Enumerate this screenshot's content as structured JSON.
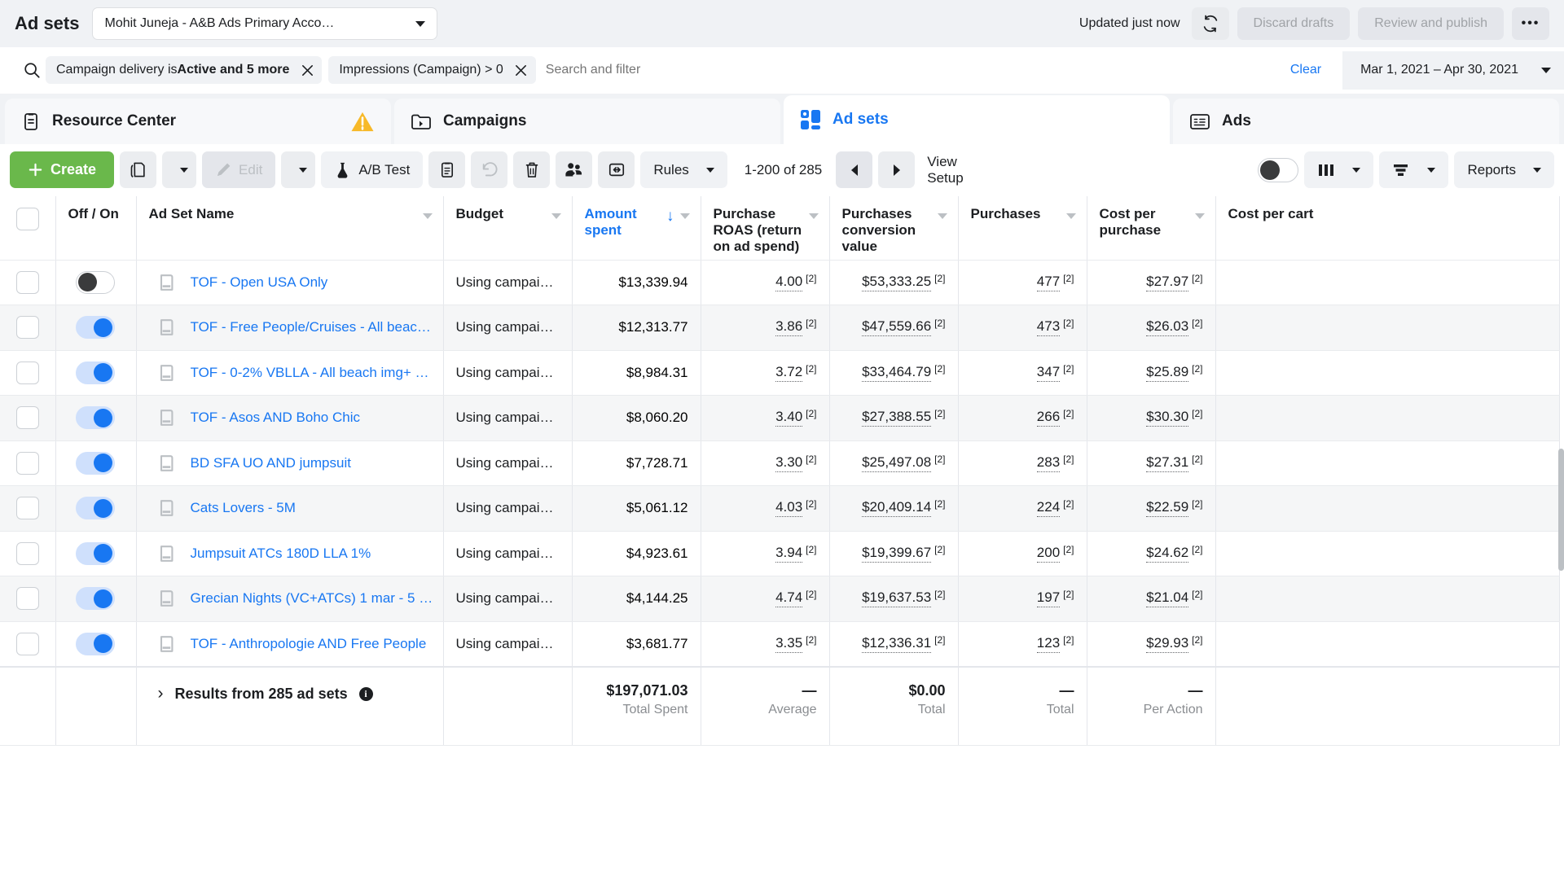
{
  "header": {
    "page_title": "Ad sets",
    "account_name": "Mohit Juneja - A&B Ads Primary Acco…",
    "updated_text": "Updated just now",
    "refresh_icon": "refresh-icon",
    "discard_drafts_label": "Discard drafts",
    "review_publish_label": "Review and publish",
    "more_label": "•••"
  },
  "filterbar": {
    "search_icon": "search-icon",
    "pills": [
      {
        "prefix": "Campaign delivery is ",
        "bold": "Active and 5 more",
        "close_icon": "close-icon"
      },
      {
        "prefix": "Impressions (Campaign) > 0",
        "bold": "",
        "close_icon": "close-icon"
      }
    ],
    "placeholder": "Search and filter",
    "clear_label": "Clear",
    "date_range": "Mar 1, 2021 – Apr 30, 2021"
  },
  "tabs": [
    {
      "label": "Resource Center",
      "icon": "clipboard-icon",
      "active": false,
      "warning_icon": "warning-triangle-icon"
    },
    {
      "label": "Campaigns",
      "icon": "campaign-folder-icon",
      "active": false,
      "warning_icon": ""
    },
    {
      "label": "Ad sets",
      "icon": "adsets-grid-icon",
      "active": true,
      "warning_icon": ""
    },
    {
      "label": "Ads",
      "icon": "ads-card-icon",
      "active": false,
      "warning_icon": ""
    }
  ],
  "toolbar": {
    "create_label": "Create",
    "duplicate_icon": "duplicate-icon",
    "duplicate_caret_icon": "chevron-down-icon",
    "edit_label": "Edit",
    "edit_icon": "pencil-icon",
    "edit_caret_icon": "chevron-down-icon",
    "ab_test_label": "A/B Test",
    "ab_test_icon": "flask-icon",
    "clipboard_icon": "clipboard-copy-icon",
    "undo_icon": "undo-icon",
    "delete_icon": "trash-icon",
    "audience_icon": "audience-export-icon",
    "share_icon": "share-arrow-icon",
    "rules_label": "Rules",
    "rules_caret_icon": "chevron-down-icon",
    "pagination_count": "1-200 of 285",
    "prev_icon": "triangle-left-icon",
    "next_icon": "triangle-right-icon",
    "view_setup_line1": "View",
    "view_setup_line2": "Setup",
    "view_toggle_icon": "toggle-switch-off",
    "columns_icon": "columns-icon",
    "columns_caret_icon": "chevron-down-icon",
    "breakdown_icon": "breakdown-icon",
    "breakdown_caret_icon": "chevron-down-icon",
    "reports_label": "Reports",
    "reports_caret_icon": "chevron-down-icon"
  },
  "table": {
    "columns": [
      {
        "key": "checkbox",
        "label": "",
        "align": "center",
        "menu": false
      },
      {
        "key": "offon",
        "label": "Off / On",
        "align": "left",
        "menu": false
      },
      {
        "key": "name",
        "label": "Ad Set Name",
        "align": "left",
        "menu": true
      },
      {
        "key": "budget",
        "label": "Budget",
        "align": "left",
        "menu": true
      },
      {
        "key": "spent",
        "label": "Amount spent",
        "align": "right",
        "menu": true,
        "sorted": true,
        "sort_dir": "↓"
      },
      {
        "key": "roas",
        "label": "Purchase ROAS (return on ad spend)",
        "align": "right",
        "menu": true
      },
      {
        "key": "convvalue",
        "label": "Purchases conversion value",
        "align": "right",
        "menu": true
      },
      {
        "key": "purchases",
        "label": "Purchases",
        "align": "right",
        "menu": true
      },
      {
        "key": "cpp",
        "label": "Cost per purchase",
        "align": "right",
        "menu": true
      },
      {
        "key": "cpc",
        "label": "Cost per cart",
        "align": "right",
        "menu": false
      }
    ],
    "rows": [
      {
        "on": false,
        "name": "TOF - Open USA Only",
        "icon": "mobile-placement-icon",
        "budget": "Using campaig…",
        "spent": "$13,339.94",
        "roas": "4.00",
        "roas_sup": "[2]",
        "convvalue": "$53,333.25",
        "convvalue_sup": "[2]",
        "purchases": "477",
        "purchases_sup": "[2]",
        "cpp": "$27.97",
        "cpp_sup": "[2]",
        "cpc": ""
      },
      {
        "on": true,
        "name": "TOF - Free People/Cruises - All beac…",
        "icon": "mobile-placement-icon",
        "budget": "Using campaig…",
        "spent": "$12,313.77",
        "roas": "3.86",
        "roas_sup": "[2]",
        "convvalue": "$47,559.66",
        "convvalue_sup": "[2]",
        "purchases": "473",
        "purchases_sup": "[2]",
        "cpp": "$26.03",
        "cpp_sup": "[2]",
        "cpc": ""
      },
      {
        "on": true,
        "name": "TOF - 0-2% VBLLA - All beach img+ …",
        "icon": "mobile-placement-icon",
        "budget": "Using campaig…",
        "spent": "$8,984.31",
        "roas": "3.72",
        "roas_sup": "[2]",
        "convvalue": "$33,464.79",
        "convvalue_sup": "[2]",
        "purchases": "347",
        "purchases_sup": "[2]",
        "cpp": "$25.89",
        "cpp_sup": "[2]",
        "cpc": ""
      },
      {
        "on": true,
        "name": "TOF - Asos AND Boho Chic",
        "icon": "mobile-placement-icon",
        "budget": "Using campaig…",
        "spent": "$8,060.20",
        "roas": "3.40",
        "roas_sup": "[2]",
        "convvalue": "$27,388.55",
        "convvalue_sup": "[2]",
        "purchases": "266",
        "purchases_sup": "[2]",
        "cpp": "$30.30",
        "cpp_sup": "[2]",
        "cpc": ""
      },
      {
        "on": true,
        "name": "BD SFA UO AND jumpsuit",
        "icon": "mobile-placement-icon",
        "budget": "Using campaig…",
        "spent": "$7,728.71",
        "roas": "3.30",
        "roas_sup": "[2]",
        "convvalue": "$25,497.08",
        "convvalue_sup": "[2]",
        "purchases": "283",
        "purchases_sup": "[2]",
        "cpp": "$27.31",
        "cpp_sup": "[2]",
        "cpc": ""
      },
      {
        "on": true,
        "name": "Cats Lovers - 5M",
        "icon": "mobile-placement-icon",
        "budget": "Using campaig…",
        "spent": "$5,061.12",
        "roas": "4.03",
        "roas_sup": "[2]",
        "convvalue": "$20,409.14",
        "convvalue_sup": "[2]",
        "purchases": "224",
        "purchases_sup": "[2]",
        "cpp": "$22.59",
        "cpp_sup": "[2]",
        "cpc": ""
      },
      {
        "on": true,
        "name": "Jumpsuit ATCs 180D LLA 1%",
        "icon": "mobile-placement-icon",
        "budget": "Using campaig…",
        "spent": "$4,923.61",
        "roas": "3.94",
        "roas_sup": "[2]",
        "convvalue": "$19,399.67",
        "convvalue_sup": "[2]",
        "purchases": "200",
        "purchases_sup": "[2]",
        "cpp": "$24.62",
        "cpp_sup": "[2]",
        "cpc": ""
      },
      {
        "on": true,
        "name": "Grecian Nights (VC+ATCs) 1 mar - 5 …",
        "icon": "mobile-placement-icon",
        "budget": "Using campaig…",
        "spent": "$4,144.25",
        "roas": "4.74",
        "roas_sup": "[2]",
        "convvalue": "$19,637.53",
        "convvalue_sup": "[2]",
        "purchases": "197",
        "purchases_sup": "[2]",
        "cpp": "$21.04",
        "cpp_sup": "[2]",
        "cpc": ""
      },
      {
        "on": true,
        "name": "TOF - Anthropologie AND Free People",
        "icon": "mobile-placement-icon",
        "budget": "Using campaig…",
        "spent": "$3,681.77",
        "roas": "3.35",
        "roas_sup": "[2]",
        "convvalue": "$12,336.31",
        "convvalue_sup": "[2]",
        "purchases": "123",
        "purchases_sup": "[2]",
        "cpp": "$29.93",
        "cpp_sup": "[2]",
        "cpc": ""
      }
    ],
    "footer": {
      "results_label": "Results from 285 ad sets",
      "expand_icon": "chevron-right-icon",
      "info_icon": "info-icon",
      "spent_value": "$197,071.03",
      "spent_label": "Total Spent",
      "roas_value": "—",
      "roas_label": "Average",
      "convvalue_value": "$0.00",
      "convvalue_label": "Total",
      "purchases_value": "—",
      "purchases_label": "Total",
      "cpp_value": "—",
      "cpp_label": "Per Action"
    }
  },
  "colors": {
    "brand_blue": "#1877f2",
    "create_green": "#6ab84b",
    "warning_yellow": "#f7b928",
    "chrome_grey": "#f0f2f5",
    "text_primary": "#1c1e21",
    "text_secondary": "#8a8d91"
  }
}
